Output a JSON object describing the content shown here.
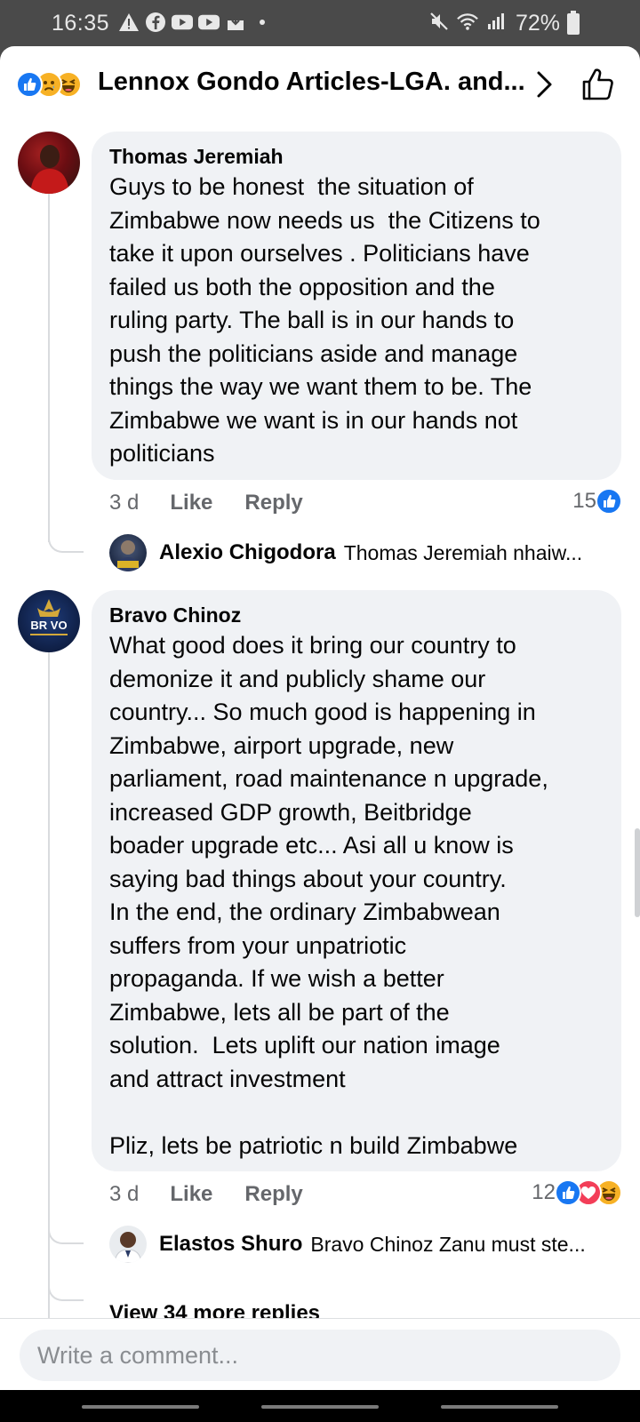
{
  "status_bar": {
    "time": "16:35",
    "battery": "72%",
    "icons_left": [
      "warning-icon",
      "facebook-icon",
      "youtube-icon",
      "youtube-icon",
      "download-icon",
      "dot-icon"
    ],
    "icons_right": [
      "mute-icon",
      "wifi-icon",
      "signal-icon",
      "battery-icon"
    ]
  },
  "header": {
    "title": "Lennox Gondo Articles-LGA. and...",
    "reaction_icons": [
      "like-reaction-icon",
      "sad-reaction-icon",
      "haha-reaction-icon"
    ]
  },
  "comments": [
    {
      "author": "Thomas Jeremiah",
      "text": "Guys to be honest  the situation of\nZimbabwe now needs us  the Citizens to\ntake it upon ourselves . Politicians have\nfailed us both the opposition and the\nruling party. The ball is in our hands to\npush the politicians aside and manage\nthings the way we want them to be. The\nZimbabwe we want is in our hands not\npoliticians",
      "time": "3 d",
      "like_label": "Like",
      "reply_label": "Reply",
      "reaction_count": "15",
      "reply_preview": {
        "author": "Alexio Chigodora",
        "text": "Thomas Jeremiah nhaiw..."
      }
    },
    {
      "author": "Bravo Chinoz",
      "text": "What good does it bring our country to\ndemonize it and publicly shame our\ncountry... So much good is happening in\nZimbabwe, airport upgrade, new\nparliament, road maintenance n upgrade,\nincreased GDP growth, Beitbridge\nboader upgrade etc... Asi all u know is\nsaying bad things about your country.\nIn the end, the ordinary Zimbabwean\nsuffers from your unpatriotic\npropaganda. If we wish a better\nZimbabwe, lets all be part of the\nsolution.  Lets uplift our nation image\nand attract investment\n\nPliz, lets be patriotic n build Zimbabwe",
      "time": "3 d",
      "like_label": "Like",
      "reply_label": "Reply",
      "reaction_count": "12",
      "avatar_text": "BR VO",
      "reply_preview": {
        "author": "Elastos Shuro",
        "text": "Bravo Chinoz  Zanu must ste..."
      },
      "more_replies": "View 34 more replies"
    }
  ],
  "composer": {
    "placeholder": "Write a comment..."
  },
  "colors": {
    "facebook_blue": "#1877f2",
    "love_red": "#f33e58",
    "haha_yellow": "#f7b125",
    "bubble_bg": "#f0f2f5",
    "muted_text": "#65676b"
  }
}
